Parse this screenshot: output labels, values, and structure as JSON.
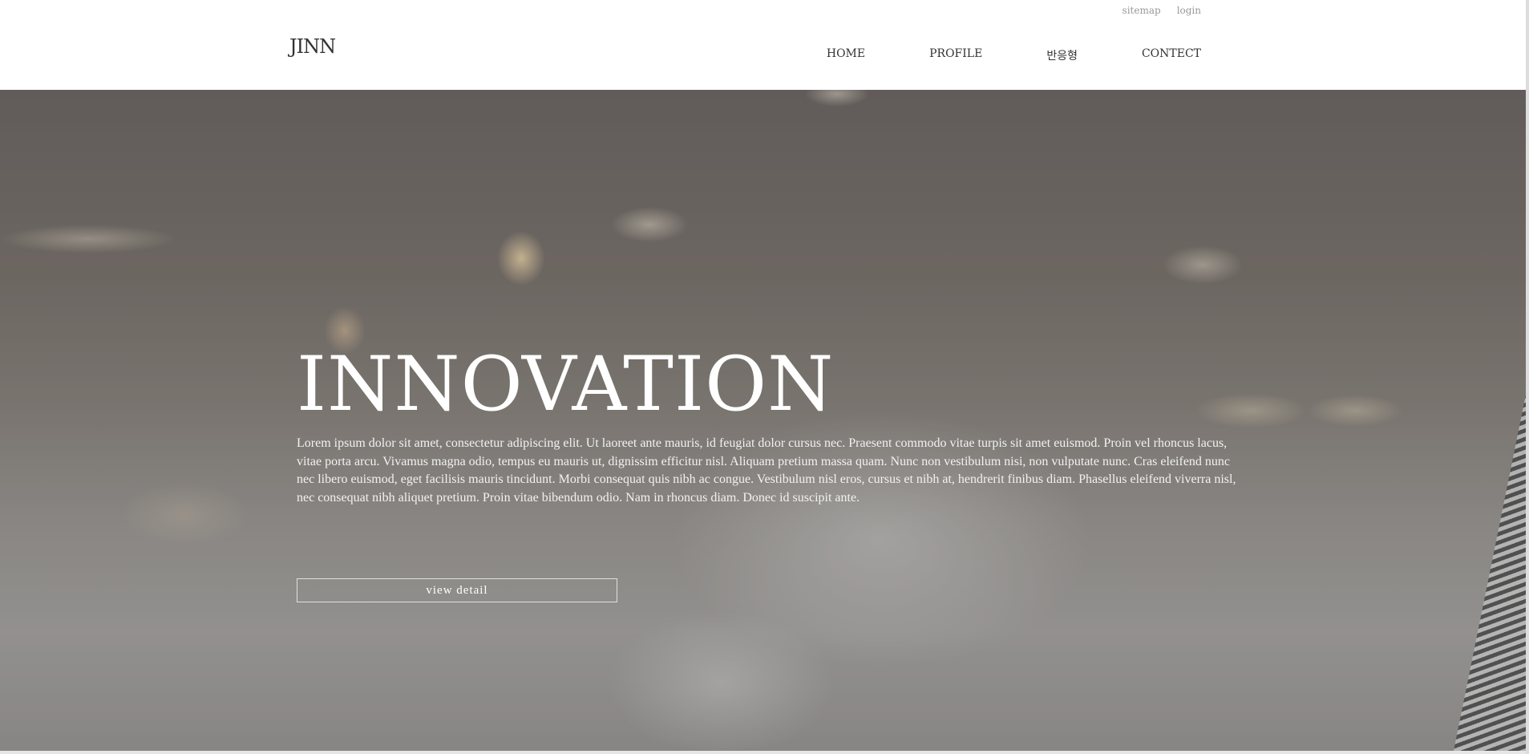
{
  "header": {
    "logo": "JINN",
    "util_links": [
      "sitemap",
      "login"
    ],
    "nav": [
      "HOME",
      "PROFILE",
      "반응형",
      "CONTECT"
    ]
  },
  "hero": {
    "title": "INNOVATION",
    "description": "Lorem ipsum dolor sit amet, consectetur adipiscing elit. Ut laoreet ante mauris, id feugiat dolor cursus nec. Praesent commodo vitae turpis sit amet euismod. Proin vel rhoncus lacus, vitae porta arcu. Vivamus magna odio, tempus eu mauris ut, dignissim efficitur nisl. Aliquam pretium massa quam. Nunc non vestibulum nisi, non vulputate nunc. Cras eleifend nunc nec libero euismod, eget facilisis mauris tincidunt. Morbi consequat quis nibh ac congue. Vestibulum nisl eros, cursus et nibh at, hendrerit finibus diam. Phasellus eleifend viverra nisl, nec consequat nibh aliquet pretium. Proin vitae bibendum odio. Nam in rhoncus diam. Donec id suscipit ante.",
    "button_label": "view detail"
  },
  "colors": {
    "header_bg": "#ffffff",
    "nav_text": "#333333",
    "util_text": "#999999",
    "hero_text": "#ffffff"
  }
}
